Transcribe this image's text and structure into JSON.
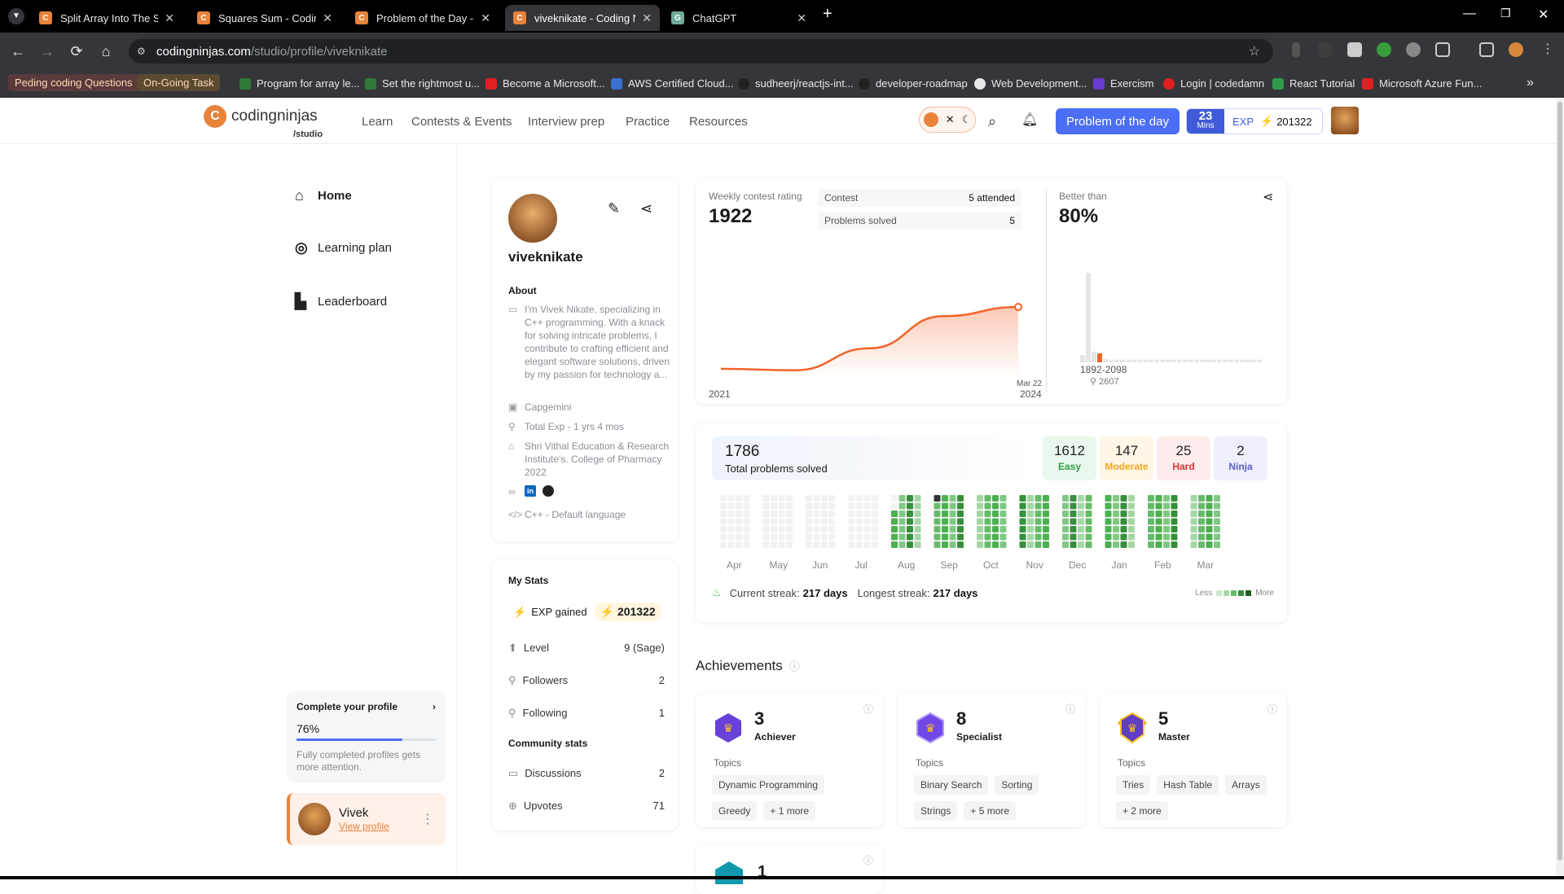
{
  "browser": {
    "tabs": [
      {
        "title": "Split Array Into The Subsets - C",
        "favicon": "cn"
      },
      {
        "title": "Squares Sum - Coding Ninjas",
        "favicon": "cn"
      },
      {
        "title": "Problem of the Day - Solve a N",
        "favicon": "cn"
      },
      {
        "title": "viveknikate - Coding Ninjas",
        "favicon": "cn"
      },
      {
        "title": "ChatGPT",
        "favicon": "gpt"
      }
    ],
    "active_tab_index": 3,
    "url_domain": "codingninjas.com",
    "url_path": "/studio/profile/viveknikate",
    "bookmarks": [
      "Peding coding Questions",
      "On-Going Task",
      "Program for array le...",
      "Set the rightmost u...",
      "Become a Microsoft...",
      "AWS Certified Cloud...",
      "sudheerj/reactjs-int...",
      "developer-roadmap",
      "Web Development...",
      "Exercism",
      "Login | codedamn",
      "React Tutorial",
      "Microsoft Azure Fun..."
    ]
  },
  "header": {
    "logo_word": "codingninjas",
    "logo_sub": "/studio",
    "nav": [
      "Learn",
      "Contests & Events",
      "Interview prep",
      "Practice",
      "Resources"
    ],
    "potd_label": "Problem of the day",
    "streak_mins": "23",
    "streak_unit": "Mins",
    "exp_label": "EXP",
    "exp_value": "201322"
  },
  "sidebar": {
    "items": [
      {
        "label": "Home",
        "icon": "home-icon"
      },
      {
        "label": "Learning plan",
        "icon": "target-icon"
      },
      {
        "label": "Leaderboard",
        "icon": "leaderboard-icon"
      }
    ],
    "complete_title": "Complete your profile",
    "complete_percent": "76%",
    "complete_fraction": 0.76,
    "complete_desc": "Fully completed profiles gets more attention.",
    "user_name": "Vivek",
    "user_link": "View profile"
  },
  "profile": {
    "username": "viveknikate",
    "about_heading": "About",
    "about": "I'm Vivek Nikate, specializing in C++ programming. With a knack for solving intricate problems, I contribute to crafting efficient and elegant software solutions, driven by my passion for technology a...",
    "company": "Capgemini",
    "experience": "Total Exp - 1 yrs 4 mos",
    "education": "Shri Vithal Education & Research Institute's. College of Pharmacy 2022",
    "language": "C++ - Default language"
  },
  "my_stats": {
    "heading": "My Stats",
    "exp_label": "EXP gained",
    "exp_value": "201322",
    "rows": [
      {
        "label": "Level",
        "value": "9 (Sage)"
      },
      {
        "label": "Followers",
        "value": "2"
      },
      {
        "label": "Following",
        "value": "1"
      }
    ],
    "community_heading": "Community stats",
    "community_rows": [
      {
        "label": "Discussions",
        "value": "2"
      },
      {
        "label": "Upvotes",
        "value": "71"
      }
    ]
  },
  "contest": {
    "label": "Weekly contest rating",
    "rating": "1922",
    "contest_label": "Contest",
    "contest_value": "5 attended",
    "solved_label": "Problems solved",
    "solved_value": "5",
    "x_start": "2021",
    "x_end": "2024",
    "last_point_label": "Mar 22",
    "better_than_label": "Better than",
    "better_than_value": "80%",
    "hist_range": "1892-2098",
    "hist_count": "2607"
  },
  "chart_data": [
    {
      "type": "area",
      "title": "Weekly contest rating",
      "x": [
        0,
        0.25,
        0.5,
        0.75,
        1.0
      ],
      "y": [
        1500,
        1490,
        1640,
        1860,
        1922
      ],
      "xlabel_start": "2021",
      "xlabel_end": "2024",
      "accent": "#f2642b"
    },
    {
      "type": "bar",
      "values": [
        0.08,
        1.0,
        0.12,
        0.1,
        0.04,
        0.03,
        0.03,
        0.03,
        0.03,
        0.03,
        0.03,
        0.03,
        0.03,
        0.03,
        0.03,
        0.03,
        0.03,
        0.03,
        0.03,
        0.03,
        0.03,
        0.03,
        0.03,
        0.03,
        0.03,
        0.03,
        0.03,
        0.03,
        0.03,
        0.03,
        0.03,
        0.03
      ],
      "highlight_index": 3,
      "highlight_color": "#f2642b",
      "xlabel": "1892-2098"
    }
  ],
  "problems": {
    "total": "1786",
    "total_label": "Total problems solved",
    "breakdown": [
      {
        "count": "1612",
        "label": "Easy",
        "color": "#2f9e44",
        "bg": "#eaf7ec"
      },
      {
        "count": "147",
        "label": "Moderate",
        "color": "#f5a623",
        "bg": "#fff6e5"
      },
      {
        "count": "25",
        "label": "Hard",
        "color": "#e03131",
        "bg": "#fdecec"
      },
      {
        "count": "2",
        "label": "Ninja",
        "color": "#5c5fc8",
        "bg": "#eeeffa"
      }
    ],
    "months": [
      "Apr",
      "May",
      "Jun",
      "Jul",
      "Aug",
      "Sep",
      "Oct",
      "Nov",
      "Dec",
      "Jan",
      "Feb",
      "Mar"
    ],
    "current_streak_label": "Current streak:",
    "current_streak": "217 days",
    "longest_streak_label": "Longest streak:",
    "longest_streak": "217 days",
    "legend_less": "Less",
    "legend_more": "More"
  },
  "achievements": {
    "title": "Achievements",
    "topics_label": "Topics",
    "cards": [
      {
        "count": "3",
        "name": "Achiever",
        "tags": [
          "Dynamic Programming",
          "Greedy",
          "+ 1 more"
        ],
        "color": "#6741d9"
      },
      {
        "count": "8",
        "name": "Specialist",
        "tags": [
          "Binary Search",
          "Sorting",
          "Strings",
          "+ 5 more"
        ],
        "color": "#7048e8"
      },
      {
        "count": "5",
        "name": "Master",
        "tags": [
          "Tries",
          "Hash Table",
          "Arrays",
          "+ 2 more"
        ],
        "color": "#5f3dc4"
      }
    ],
    "partial_count": "1"
  }
}
